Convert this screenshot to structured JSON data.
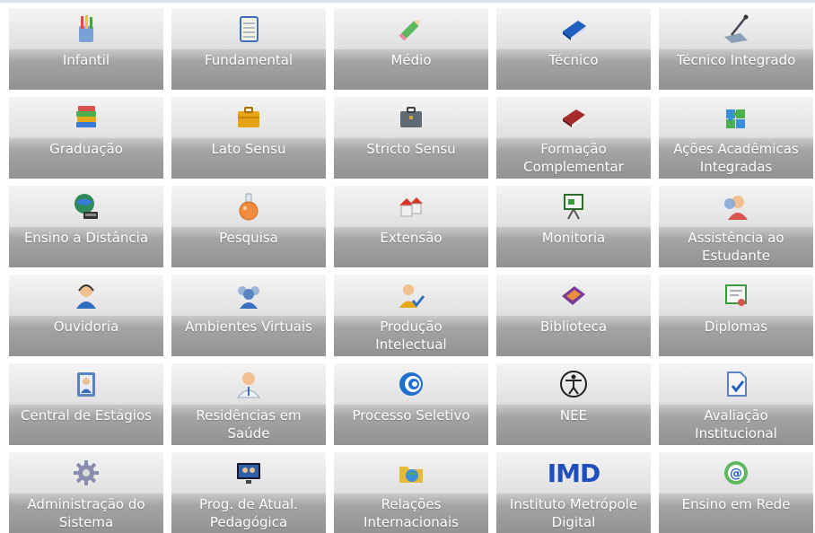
{
  "tiles": [
    {
      "label": "Infantil",
      "icon": "pencil-cup-icon"
    },
    {
      "label": "Fundamental",
      "icon": "notepad-icon"
    },
    {
      "label": "Médio",
      "icon": "green-pencil-icon"
    },
    {
      "label": "Técnico",
      "icon": "blue-book-icon"
    },
    {
      "label": "Técnico Integrado",
      "icon": "drawing-board-icon"
    },
    {
      "label": "Graduação",
      "icon": "book-stack-icon"
    },
    {
      "label": "Lato Sensu",
      "icon": "yellow-briefcase-icon"
    },
    {
      "label": "Stricto Sensu",
      "icon": "gray-briefcase-icon"
    },
    {
      "label": "Formação\nComplementar",
      "icon": "red-book-icon"
    },
    {
      "label": "Ações Acadêmicas\nIntegradas",
      "icon": "puzzle-icon"
    },
    {
      "label": "Ensino a Distância",
      "icon": "globe-computer-icon"
    },
    {
      "label": "Pesquisa",
      "icon": "flask-icon"
    },
    {
      "label": "Extensão",
      "icon": "houses-icon"
    },
    {
      "label": "Monitoria",
      "icon": "presentation-board-icon"
    },
    {
      "label": "Assistência ao\nEstudante",
      "icon": "person-support-icon"
    },
    {
      "label": "Ouvidoria",
      "icon": "headset-person-icon"
    },
    {
      "label": "Ambientes Virtuais",
      "icon": "people-group-icon"
    },
    {
      "label": "Produção\nIntelectual",
      "icon": "person-check-icon"
    },
    {
      "label": "Biblioteca",
      "icon": "purple-book-icon"
    },
    {
      "label": "Diplomas",
      "icon": "certificate-icon"
    },
    {
      "label": "Central de Estágios",
      "icon": "contact-book-icon"
    },
    {
      "label": "Residências em\nSaúde",
      "icon": "doctor-icon"
    },
    {
      "label": "Processo Seletivo",
      "icon": "spiral-logo-icon"
    },
    {
      "label": "NEE",
      "icon": "accessibility-icon"
    },
    {
      "label": "Avaliação\nInstitucional",
      "icon": "document-check-icon"
    },
    {
      "label": "Administração do\nSistema",
      "icon": "gear-icon"
    },
    {
      "label": "Prog. de Atual.\nPedagógica",
      "icon": "monitor-people-icon"
    },
    {
      "label": "Relações\nInternacionais",
      "icon": "folder-globe-icon"
    },
    {
      "label": "Instituto Metrópole\nDigital",
      "icon": "imd-logo-icon"
    },
    {
      "label": "Ensino em Rede",
      "icon": "at-globe-icon"
    }
  ],
  "imd_logo_text": "IMD"
}
